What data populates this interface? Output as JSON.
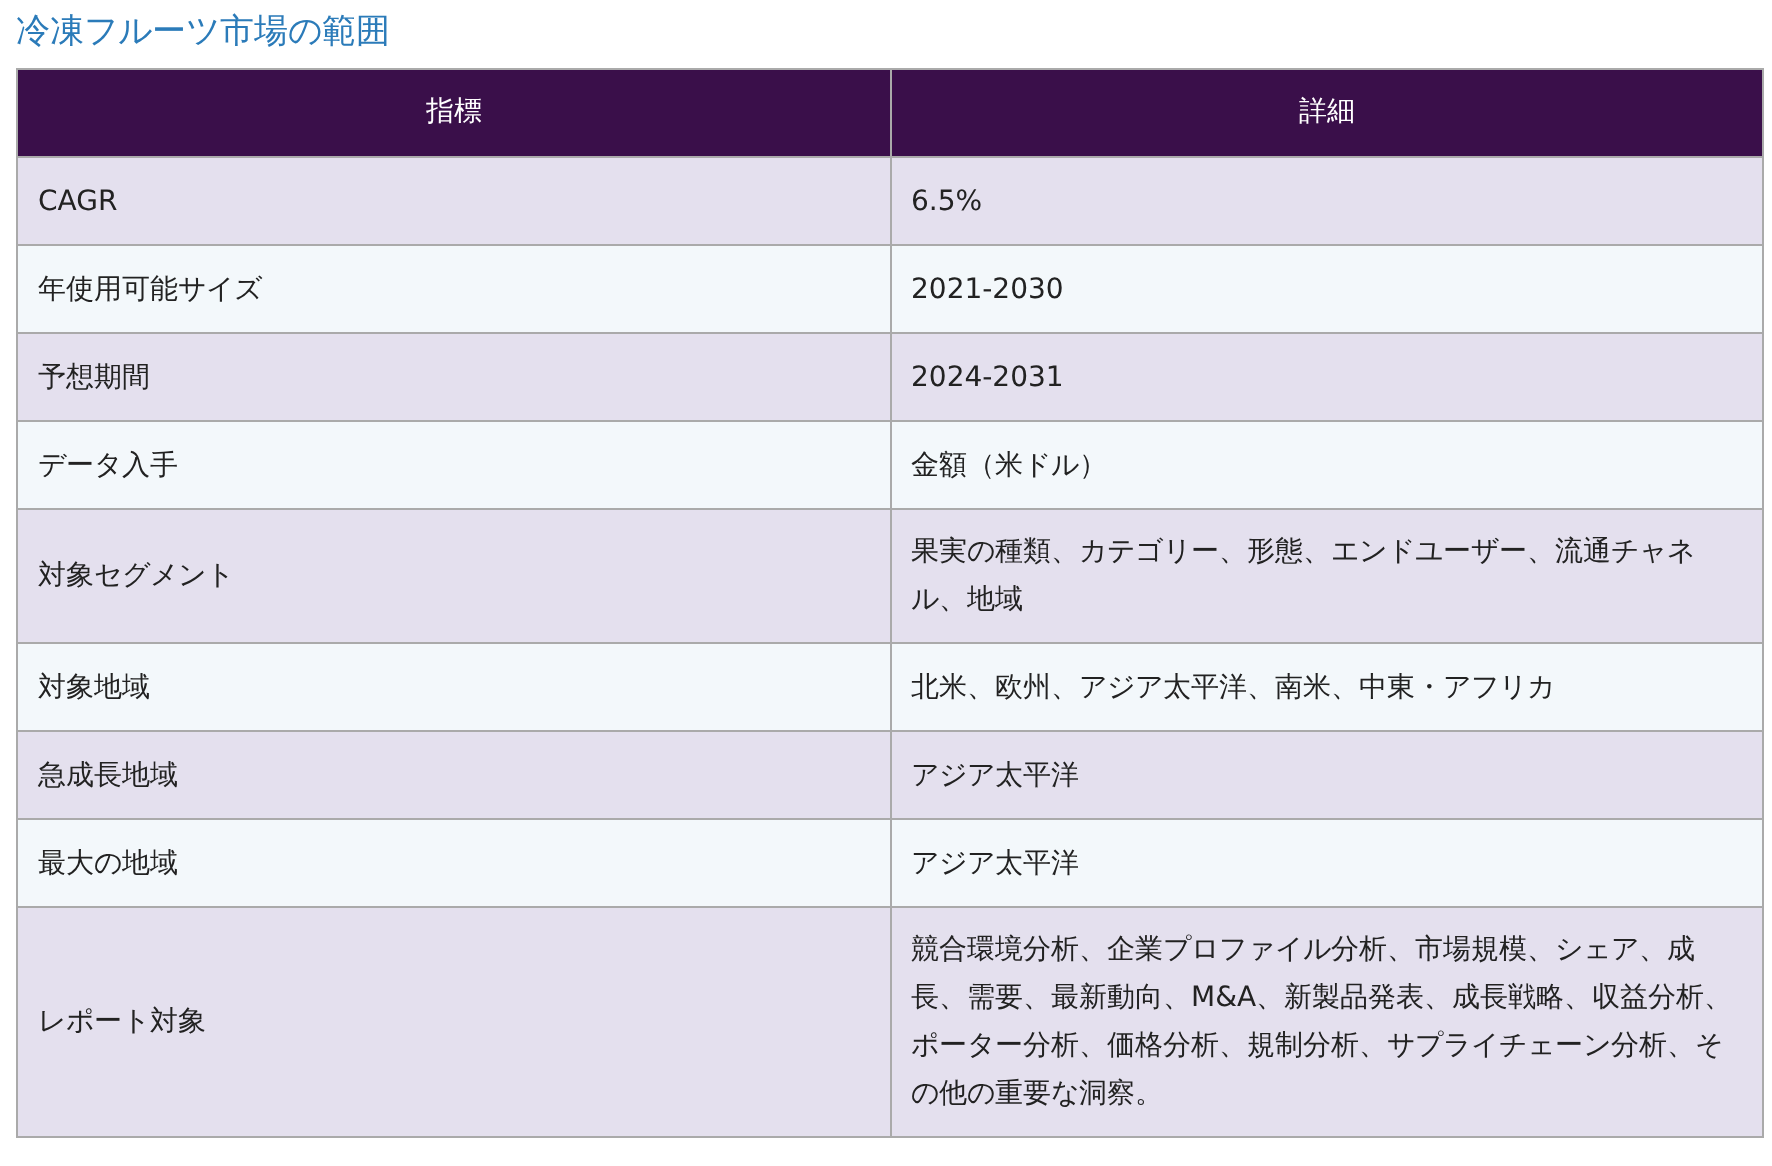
{
  "title": "冷凍フルーツ市場の範囲",
  "table": {
    "columns": [
      "指標",
      "詳細"
    ],
    "rows": [
      [
        "CAGR",
        "6.5%"
      ],
      [
        "年使用可能サイズ",
        "2021-2030"
      ],
      [
        "予想期間",
        "2024-2031"
      ],
      [
        "データ入手",
        "金額（米ドル）"
      ],
      [
        "対象セグメント",
        "果実の種類、カテゴリー、形態、エンドユーザー、流通チャネル、地域"
      ],
      [
        "対象地域",
        "北米、欧州、アジア太平洋、南米、中東・アフリカ"
      ],
      [
        "急成長地域",
        "アジア太平洋"
      ],
      [
        "最大の地域",
        "アジア太平洋"
      ],
      [
        "レポート対象",
        "競合環境分析、企業プロファイル分析、市場規模、シェア、成長、需要、最新動向、M&A、新製品発表、成長戦略、収益分析、ポーター分析、価格分析、規制分析、サプライチェーン分析、その他の重要な洞察。"
      ]
    ]
  }
}
